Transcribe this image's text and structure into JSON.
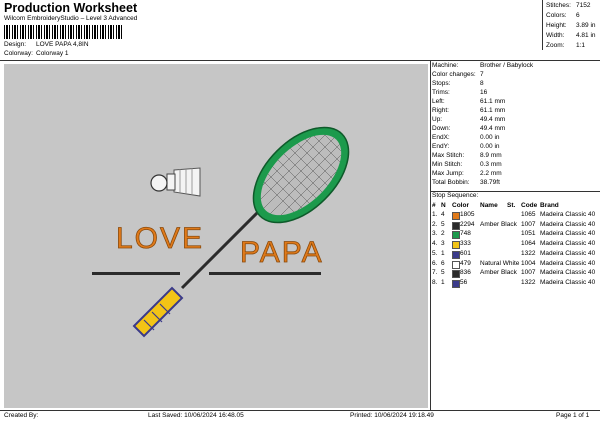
{
  "header": {
    "title": "Production Worksheet",
    "software": "Wilcom EmbroideryStudio – Level 3 Advanced",
    "design_label": "Design:",
    "design": "LOVE PAPA 4,8IN",
    "colorway_label": "Colorway:",
    "colorway": "Colorway 1"
  },
  "summary": [
    {
      "label": "Stitches:",
      "value": "7152"
    },
    {
      "label": "Colors:",
      "value": "6"
    },
    {
      "label": "Height:",
      "value": "3.89 in"
    },
    {
      "label": "Width:",
      "value": "4.81 in"
    },
    {
      "label": "Zoom:",
      "value": "1:1"
    }
  ],
  "design_text": {
    "love": "LOVE",
    "papa": "PAPA"
  },
  "machine_info": [
    {
      "label": "Machine:",
      "value": "Brother / Babylock"
    },
    {
      "label": "Color changes:",
      "value": "7"
    },
    {
      "label": "Stops:",
      "value": "8"
    },
    {
      "label": "Trims:",
      "value": "16"
    },
    {
      "label": "Left:",
      "value": "61.1 mm"
    },
    {
      "label": "Right:",
      "value": "61.1 mm"
    },
    {
      "label": "Up:",
      "value": "49.4 mm"
    },
    {
      "label": "Down:",
      "value": "49.4 mm"
    },
    {
      "label": "EndX:",
      "value": "0.00 in"
    },
    {
      "label": "EndY:",
      "value": "0.00 in"
    },
    {
      "label": "Max Stitch:",
      "value": "8.9 mm"
    },
    {
      "label": "Min Stitch:",
      "value": "0.3 mm"
    },
    {
      "label": "Max Jump:",
      "value": "2.2 mm"
    },
    {
      "label": "Total Bobbin:",
      "value": "38.79ft"
    }
  ],
  "stop_sequence": {
    "title": "Stop Sequence:",
    "columns": [
      "#",
      "N",
      "Color",
      "Name",
      "St.",
      "Code",
      "Brand"
    ],
    "rows": [
      {
        "num": "1.",
        "n": "4",
        "swatch": "#e07a1a",
        "color": "1805",
        "name": "",
        "st": "1065",
        "code": "Madeira Classic 40"
      },
      {
        "num": "2.",
        "n": "5",
        "swatch": "#2b2b2b",
        "color": "2294",
        "name": "Amber Black",
        "st": "1007",
        "code": "Madeira Classic 40"
      },
      {
        "num": "3.",
        "n": "2",
        "swatch": "#1c9a4c",
        "color": "748",
        "name": "",
        "st": "1051",
        "code": "Madeira Classic 40"
      },
      {
        "num": "4.",
        "n": "3",
        "swatch": "#f2c416",
        "color": "333",
        "name": "",
        "st": "1064",
        "code": "Madeira Classic 40"
      },
      {
        "num": "5.",
        "n": "1",
        "swatch": "#3a3a8a",
        "color": "601",
        "name": "",
        "st": "1322",
        "code": "Madeira Classic 40"
      },
      {
        "num": "6.",
        "n": "6",
        "swatch": "#ffffff",
        "color": "479",
        "name": "Natural White",
        "st": "1004",
        "code": "Madeira Classic 40"
      },
      {
        "num": "7.",
        "n": "5",
        "swatch": "#2b2b2b",
        "color": "836",
        "name": "Amber Black",
        "st": "1007",
        "code": "Madeira Classic 40"
      },
      {
        "num": "8.",
        "n": "1",
        "swatch": "#3a3a8a",
        "color": "56",
        "name": "",
        "st": "1322",
        "code": "Madeira Classic 40"
      }
    ]
  },
  "footer": {
    "created_by": "Created By:",
    "last_saved": "Last Saved: 10/06/2024 16:48.05",
    "printed": "Printed: 10/06/2024 19:18.49",
    "page": "Page 1 of 1"
  }
}
